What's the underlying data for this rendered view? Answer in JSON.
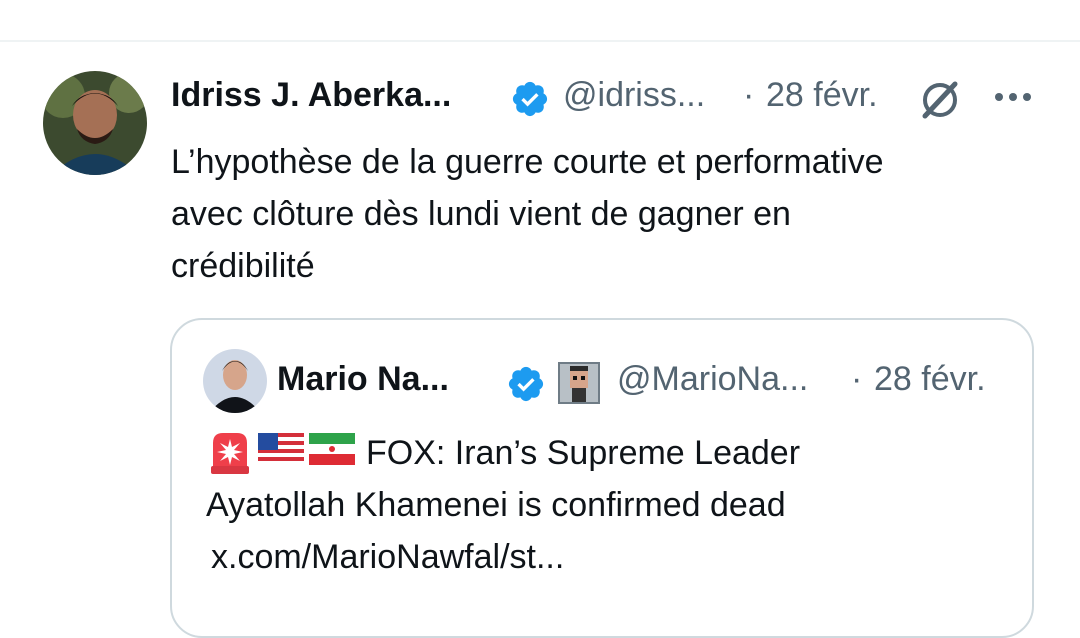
{
  "tweet": {
    "author_name": "Idriss J. Aberka...",
    "handle": "@idriss...",
    "separator": "·",
    "date": "28 févr.",
    "text": "L’hypothèse de la guerre courte et performative\navec clôture dès lundi vient de gagner en\ncrédibilité",
    "icons": {
      "verified": "verified-badge-icon",
      "grok": "grok-icon",
      "more": "more-options-icon"
    }
  },
  "quoted_tweet": {
    "author_name": "Mario Na...",
    "handle": "@MarioNa...",
    "separator": "·",
    "date": "28 févr.",
    "text": "FOX: Iran’s Supreme Leader\nAyatollah Khamenei is confirmed dead",
    "link": "x.com/MarioNawfal/st...",
    "icons": {
      "verified": "verified-badge-icon",
      "pixel_avatar_badge": "pixel-avatar-icon",
      "emojis": [
        "siren-icon",
        "us-flag-icon",
        "iran-flag-icon"
      ]
    }
  },
  "colors": {
    "verified_blue": "#1d9bf0",
    "muted_text": "#536471",
    "border": "#cfd9de",
    "text": "#0f1419"
  }
}
